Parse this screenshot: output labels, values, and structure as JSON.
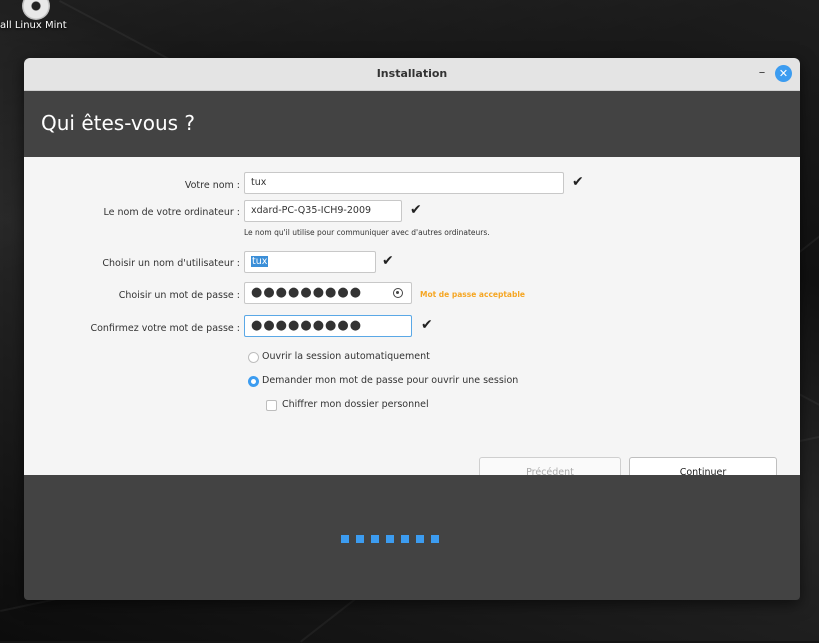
{
  "desktop": {
    "icon_label": "all Linux Mint",
    "icon_name": "disc-icon"
  },
  "window": {
    "title": "Installation",
    "minimize_symbol": "–",
    "close_symbol": "✕"
  },
  "header": {
    "heading": "Qui êtes-vous ?"
  },
  "form": {
    "name_label": "Votre nom :",
    "name_value": "tux",
    "computer_label": "Le nom de votre ordinateur :",
    "computer_value": "xdard-PC-Q35-ICH9-2009",
    "computer_hint": "Le nom qu'il utilise pour communiquer avec d'autres ordinateurs.",
    "username_label": "Choisir un nom d'utilisateur :",
    "username_value": "tux",
    "password_label": "Choisir un mot de passe :",
    "password_value": "●●●●●●●●●",
    "password_strength": "Mot de passe acceptable",
    "confirm_label": "Confirmez votre mot de passe :",
    "confirm_value": "●●●●●●●●●",
    "check_symbol": "✔"
  },
  "login_options": {
    "auto_login": "Ouvrir la session automatiquement",
    "require_password": "Demander mon mot de passe pour ouvrir une session",
    "encrypt_home": "Chiffrer mon dossier personnel",
    "selected": "require_password",
    "encrypt_checked": false
  },
  "buttons": {
    "previous": "Précédent",
    "continue": "Continuer"
  },
  "progress": {
    "steps_total": 7,
    "accent": "#3c9cf0"
  },
  "colors": {
    "header_bg": "#434343",
    "accent": "#3c9cf0",
    "strength": "#f5a623"
  }
}
